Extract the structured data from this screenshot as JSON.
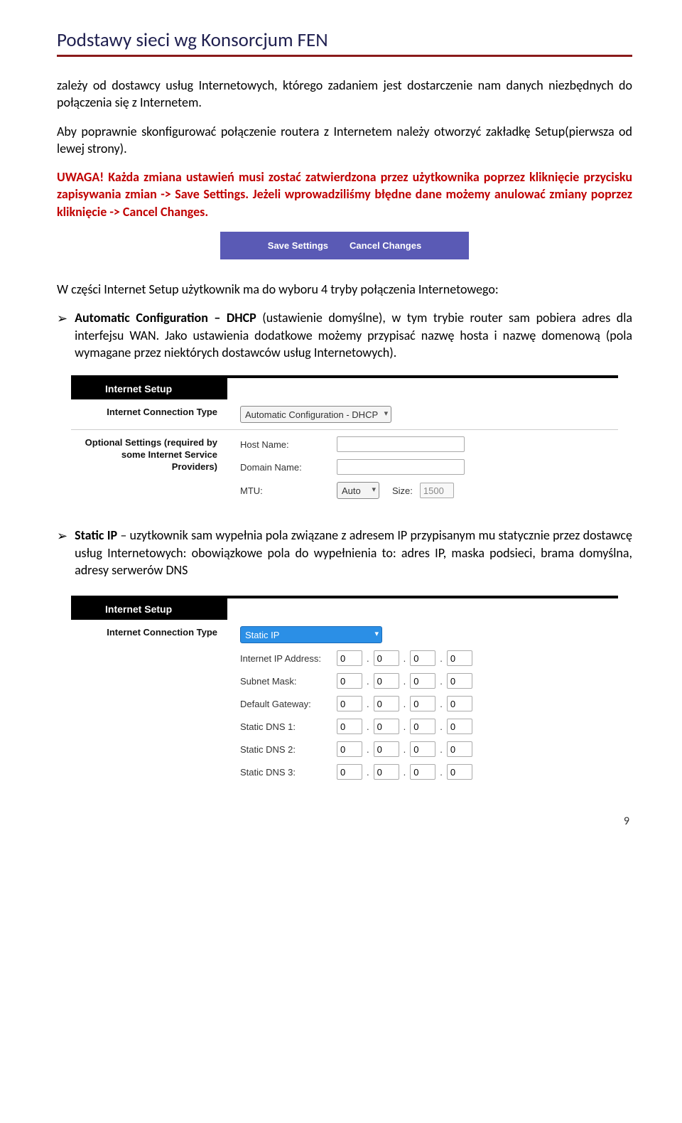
{
  "header": {
    "title": "Podstawy sieci wg Konsorcjum FEN"
  },
  "paragraphs": {
    "p1": "zależy od dostawcy usług Internetowych, którego zadaniem jest dostarczenie nam danych niezbędnych do połączenia się z Internetem.",
    "p2": "Aby poprawnie skonfigurować połączenie routera z Internetem należy otworzyć zakładkę Setup(pierwsza od lewej strony).",
    "p3": "UWAGA! Każda zmiana ustawień musi zostać zatwierdzona przez użytkownika poprzez kliknięcie przycisku zapisywania zmian -> Save Settings. Jeżeli wprowadziliśmy błędne dane możemy anulować zmiany poprzez kliknięcie -> Cancel Changes.",
    "p4_intro": "W części Internet Setup użytkownik ma do wyboru 4 tryby połączenia Internetowego:",
    "p4_bold": "Automatic Configuration – DHCP",
    "p4_rest": " (ustawienie domyślne), w tym trybie router sam pobiera adres dla interfejsu WAN. Jako ustawienia dodatkowe możemy przypisać nazwę hosta i nazwę domenową (pola wymagane przez niektórych dostawców usług Internetowych).",
    "p5_bold": "Static IP",
    "p5_rest": " – uzytkownik sam wypełnia pola związane z adresem IP przypisanym mu statycznie przez dostawcę usług Internetowych: obowiązkowe pola do wypełnienia to: adres IP, maska podsieci, brama domyślna, adresy serwerów DNS"
  },
  "save_bar": {
    "save": "Save Settings",
    "cancel": "Cancel Changes"
  },
  "panel1": {
    "title": "Internet Setup",
    "label_conn_type": "Internet Connection Type",
    "conn_value": "Automatic Configuration - DHCP",
    "label_optional": "Optional Settings (required by some Internet Service Providers)",
    "host_label": "Host Name:",
    "domain_label": "Domain Name:",
    "mtu_label": "MTU:",
    "mtu_value": "Auto",
    "size_label": "Size:",
    "size_value": "1500"
  },
  "panel2": {
    "title": "Internet Setup",
    "label_conn_type": "Internet Connection Type",
    "conn_value": "Static IP",
    "ip_label": "Internet IP Address:",
    "mask_label": "Subnet Mask:",
    "gw_label": "Default Gateway:",
    "dns1_label": "Static DNS 1:",
    "dns2_label": "Static DNS 2:",
    "dns3_label": "Static DNS 3:",
    "octet": "0",
    "dot": "."
  },
  "page_number": "9"
}
